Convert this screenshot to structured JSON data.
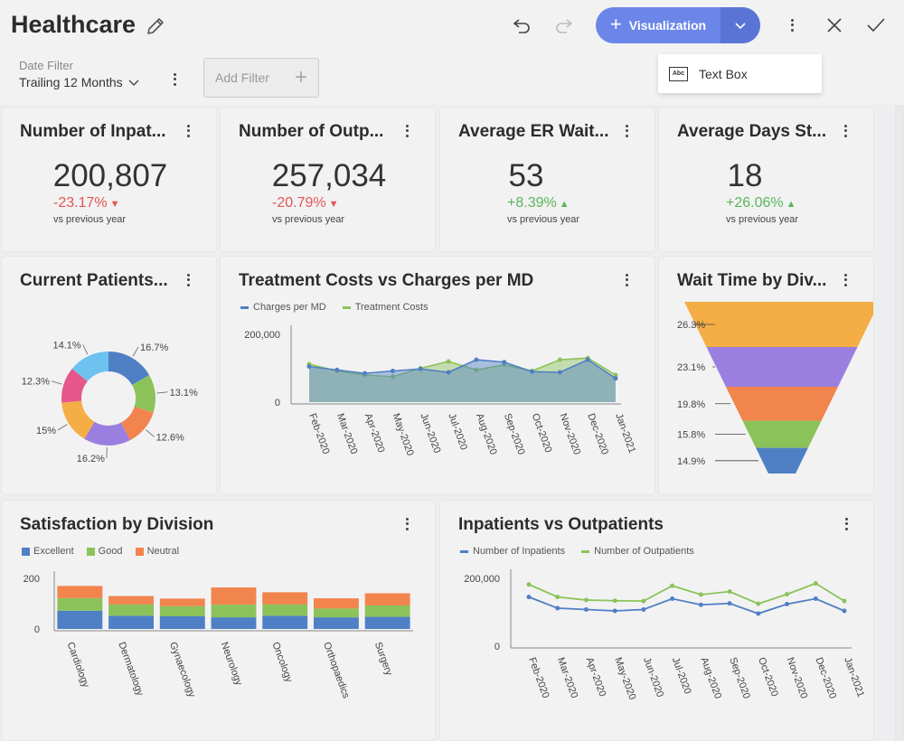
{
  "header": {
    "title": "Healthcare",
    "visualization_label": "Visualization",
    "dropdown_item": "Text Box",
    "dropdown_item_icon": "Abc"
  },
  "filters": {
    "date_filter_label": "Date Filter",
    "date_filter_value": "Trailing 12 Months",
    "add_filter_label": "Add Filter"
  },
  "kpis": [
    {
      "title": "Number of Inpat...",
      "value": "200,807",
      "delta": "-23.17%",
      "direction": "down",
      "sub": "vs previous year"
    },
    {
      "title": "Number of Outp...",
      "value": "257,034",
      "delta": "-20.79%",
      "direction": "down",
      "sub": "vs previous year"
    },
    {
      "title": "Average ER Wait...",
      "value": "53",
      "delta": "+8.39%",
      "direction": "up",
      "sub": "vs previous year"
    },
    {
      "title": "Average Days St...",
      "value": "18",
      "delta": "+26.06%",
      "direction": "up",
      "sub": "vs previous year"
    }
  ],
  "colors": {
    "blue": "#4f7fc5",
    "green": "#8bc35a",
    "orange": "#f2844e",
    "purple": "#9b7fe0",
    "yellow": "#f4ae45",
    "pink": "#e5568a",
    "lightblue": "#6dc2f0",
    "negative": "#e25555",
    "positive": "#5bb55b",
    "accent": "#6b86e8"
  },
  "chart_data": [
    {
      "type": "pie",
      "title": "Current Patients...",
      "labels": [
        "16.7%",
        "13.1%",
        "12.6%",
        "16.2%",
        "15%",
        "12.3%",
        "14.1%"
      ],
      "values": [
        16.7,
        13.1,
        12.6,
        16.2,
        15,
        12.3,
        14.1
      ],
      "colors": [
        "#4f7fc5",
        "#8bc35a",
        "#f2844e",
        "#9b7fe0",
        "#f4ae45",
        "#e5568a",
        "#6dc2f0"
      ]
    },
    {
      "type": "area",
      "title": "Treatment Costs vs Charges per MD",
      "categories": [
        "Feb-2020",
        "Mar-2020",
        "Apr-2020",
        "May-2020",
        "Jun-2020",
        "Jul-2020",
        "Aug-2020",
        "Sep-2020",
        "Oct-2020",
        "Nov-2020",
        "Dec-2020",
        "Jan-2021"
      ],
      "series": [
        {
          "name": "Charges per MD",
          "color": "#4f7fc5",
          "values": [
            105000,
            95000,
            85000,
            92000,
            98000,
            88000,
            125000,
            118000,
            90000,
            88000,
            125000,
            70000
          ]
        },
        {
          "name": "Treatment Costs",
          "color": "#8bc35a",
          "values": [
            112000,
            92000,
            80000,
            75000,
            100000,
            120000,
            95000,
            110000,
            92000,
            125000,
            130000,
            80000
          ]
        }
      ],
      "yticks": [
        "200,000",
        "0"
      ],
      "ylim": [
        0,
        200000
      ]
    },
    {
      "type": "bar",
      "title": "Wait Time by Div...",
      "values": [
        26.3,
        23.1,
        19.8,
        15.8,
        14.9
      ],
      "labels": [
        "26.3%",
        "23.1%",
        "19.8%",
        "15.8%",
        "14.9%"
      ],
      "colors": [
        "#f4ae45",
        "#9b7fe0",
        "#f2844e",
        "#8bc35a",
        "#4f7fc5"
      ]
    },
    {
      "type": "bar",
      "title": "Satisfaction by Division",
      "categories": [
        "Cardiology",
        "Dermatology",
        "Gynaecology",
        "Neurology",
        "Oncology",
        "Orthopaedics",
        "Surgery"
      ],
      "series": [
        {
          "name": "Excellent",
          "color": "#4f7fc5",
          "values": [
            72,
            52,
            50,
            46,
            52,
            46,
            48
          ]
        },
        {
          "name": "Good",
          "color": "#8bc35a",
          "values": [
            50,
            45,
            40,
            50,
            45,
            35,
            45
          ]
        },
        {
          "name": "Neutral",
          "color": "#f2844e",
          "values": [
            48,
            33,
            30,
            68,
            48,
            40,
            48
          ]
        }
      ],
      "yticks": [
        "200",
        "0"
      ],
      "ylim": [
        0,
        200
      ]
    },
    {
      "type": "line",
      "title": "Inpatients vs Outpatients",
      "categories": [
        "Feb-2020",
        "Mar-2020",
        "Apr-2020",
        "May-2020",
        "Jun-2020",
        "Jul-2020",
        "Aug-2020",
        "Sep-2020",
        "Oct-2020",
        "Nov-2020",
        "Dec-2020",
        "Jan-2021"
      ],
      "series": [
        {
          "name": "Number of Inpatients",
          "color": "#4f7fc5",
          "values": [
            145000,
            112000,
            108000,
            104000,
            108000,
            140000,
            122000,
            126000,
            96000,
            124000,
            140000,
            104000
          ]
        },
        {
          "name": "Number of Outpatients",
          "color": "#8bc35a",
          "values": [
            182000,
            145000,
            136000,
            134000,
            133000,
            178000,
            152000,
            161000,
            125000,
            153000,
            185000,
            133000
          ]
        }
      ],
      "yticks": [
        "200,000",
        "0"
      ],
      "ylim": [
        0,
        250000
      ]
    }
  ]
}
